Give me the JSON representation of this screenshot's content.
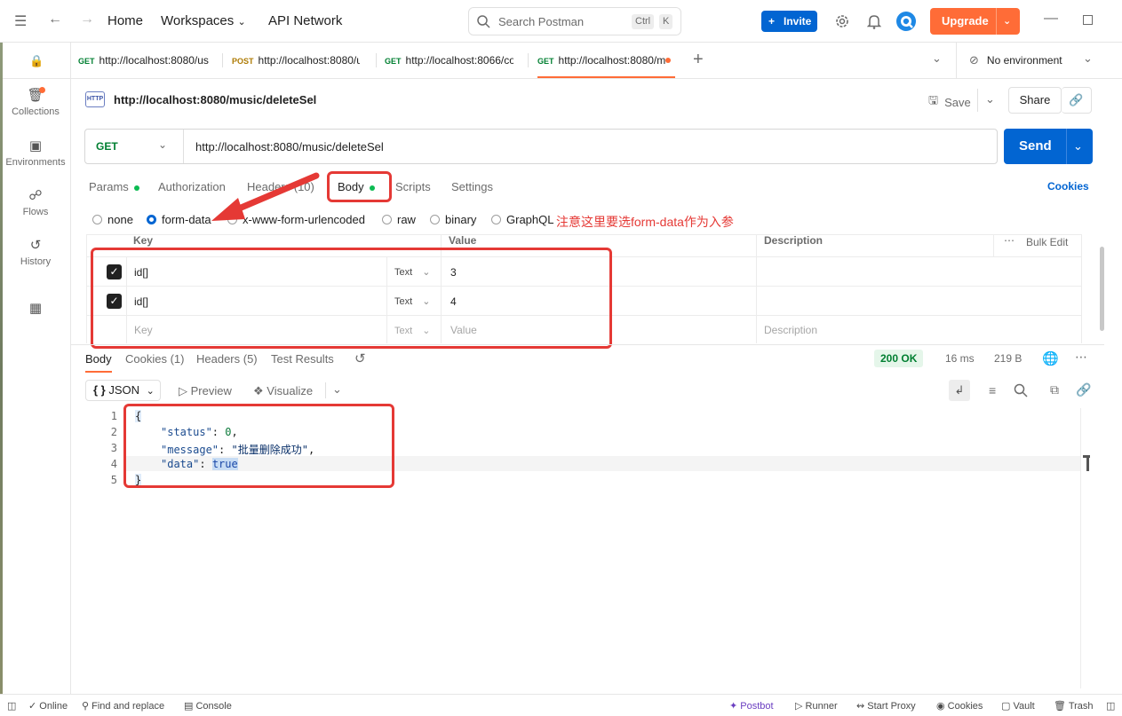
{
  "topbar": {
    "home": "Home",
    "workspaces": "Workspaces",
    "api_network": "API Network",
    "search_placeholder": "Search Postman",
    "kbd_ctrl": "Ctrl",
    "kbd_k": "K",
    "invite": "Invite",
    "upgrade": "Upgrade"
  },
  "sidebar": {
    "items": [
      {
        "label": "Collections",
        "icon": "collections-icon"
      },
      {
        "label": "Environments",
        "icon": "environments-icon"
      },
      {
        "label": "Flows",
        "icon": "flows-icon"
      },
      {
        "label": "History",
        "icon": "history-icon"
      }
    ]
  },
  "tabs": [
    {
      "method": "GET",
      "url": "http://localhost:8080/us"
    },
    {
      "method": "POST",
      "url": "http://localhost:8080/u"
    },
    {
      "method": "GET",
      "url": "http://localhost:8066/co"
    },
    {
      "method": "GET",
      "url": "http://localhost:8080/m"
    }
  ],
  "environment": "No environment",
  "request": {
    "title": "http://localhost:8080/music/deleteSel",
    "save": "Save",
    "share": "Share",
    "method": "GET",
    "url": "http://localhost:8080/music/deleteSel",
    "send": "Send"
  },
  "req_tabs": {
    "params": "Params",
    "authorization": "Authorization",
    "headers": "Headers (10)",
    "body": "Body",
    "scripts": "Scripts",
    "settings": "Settings",
    "cookies": "Cookies"
  },
  "body_types": [
    "none",
    "form-data",
    "x-www-form-urlencoded",
    "raw",
    "binary",
    "GraphQL"
  ],
  "annotation": "注意这里要选form-data作为入参",
  "table": {
    "headers": {
      "key": "Key",
      "value": "Value",
      "description": "Description",
      "bulk_edit": "Bulk Edit"
    },
    "rows": [
      {
        "key": "id[]",
        "type": "Text",
        "value": "3"
      },
      {
        "key": "id[]",
        "type": "Text",
        "value": "4"
      }
    ],
    "placeholder": {
      "key": "Key",
      "type": "Text",
      "value": "Value",
      "description": "Description"
    }
  },
  "response": {
    "tabs": {
      "body": "Body",
      "cookies": "Cookies (1)",
      "headers": "Headers (5)",
      "tests": "Test Results"
    },
    "status": "200 OK",
    "time": "16 ms",
    "size": "219 B",
    "format": "JSON",
    "preview": "Preview",
    "visualize": "Visualize",
    "lines": [
      "1",
      "2",
      "3",
      "4",
      "5"
    ],
    "json": {
      "open": "{",
      "status_key": "\"status\"",
      "status_val": "0",
      "message_key": "\"message\"",
      "message_val": "\"批量删除成功\"",
      "data_key": "\"data\"",
      "data_val": "true",
      "close": "}"
    }
  },
  "statusbar": {
    "online": "Online",
    "find": "Find and replace",
    "console": "Console",
    "postbot": "Postbot",
    "runner": "Runner",
    "proxy": "Start Proxy",
    "cookies": "Cookies",
    "vault": "Vault",
    "trash": "Trash"
  }
}
